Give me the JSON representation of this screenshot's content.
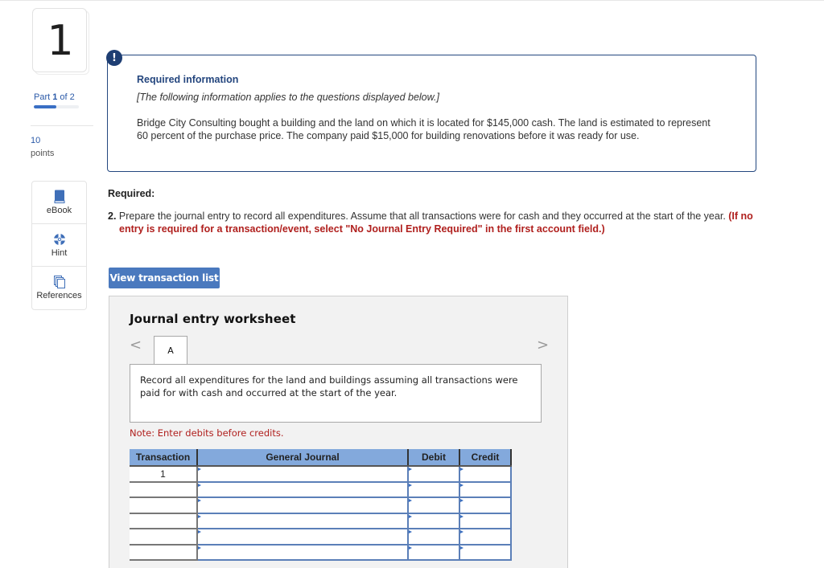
{
  "question": {
    "number": "1",
    "part_label_prefix": "Part ",
    "part_current": "1",
    "part_label_suffix": " of 2",
    "part_progress_fraction": 0.5,
    "points_value": "10",
    "points_label": "points"
  },
  "tools": [
    {
      "label": "eBook",
      "icon": "book-icon"
    },
    {
      "label": "Hint",
      "icon": "lifebuoy-icon"
    },
    {
      "label": "References",
      "icon": "documents-icon"
    }
  ],
  "info": {
    "badge": "!",
    "title": "Required information",
    "subtitle": "[The following information applies to the questions displayed below.]",
    "body": "Bridge City Consulting bought a building and the land on which it is located for $145,000 cash. The land is estimated to represent 60 percent of the purchase price. The company paid $15,000 for building renovations before it was ready for use."
  },
  "required": {
    "heading": "Required:",
    "item_number": "2.",
    "item_text": " Prepare the journal entry to record all expenditures. Assume that all transactions were for cash and they occurred at the start of the year. ",
    "item_note": "(If no entry is required for a transaction/event, select \"No Journal Entry Required\" in the first account field.)"
  },
  "view_transaction_button": "View transaction list",
  "worksheet": {
    "title": "Journal entry worksheet",
    "prev_glyph": "<",
    "next_glyph": ">",
    "active_tab": "A",
    "description": "Record all expenditures for the land and buildings assuming all transactions were paid for with cash and occurred at the start of the year.",
    "note": "Note: Enter debits before credits.",
    "columns": [
      "Transaction",
      "General Journal",
      "Debit",
      "Credit"
    ],
    "rows": [
      {
        "transaction": "1",
        "account": "",
        "debit": "",
        "credit": ""
      },
      {
        "transaction": "",
        "account": "",
        "debit": "",
        "credit": ""
      },
      {
        "transaction": "",
        "account": "",
        "debit": "",
        "credit": ""
      },
      {
        "transaction": "",
        "account": "",
        "debit": "",
        "credit": ""
      },
      {
        "transaction": "",
        "account": "",
        "debit": "",
        "credit": ""
      },
      {
        "transaction": "",
        "account": "",
        "debit": "",
        "credit": ""
      }
    ]
  },
  "colors": {
    "accent_blue": "#2b5aa8",
    "info_border": "#23477f",
    "button_blue": "#4a79be",
    "alert_red": "#b0201e",
    "table_header": "#83a9dc"
  }
}
